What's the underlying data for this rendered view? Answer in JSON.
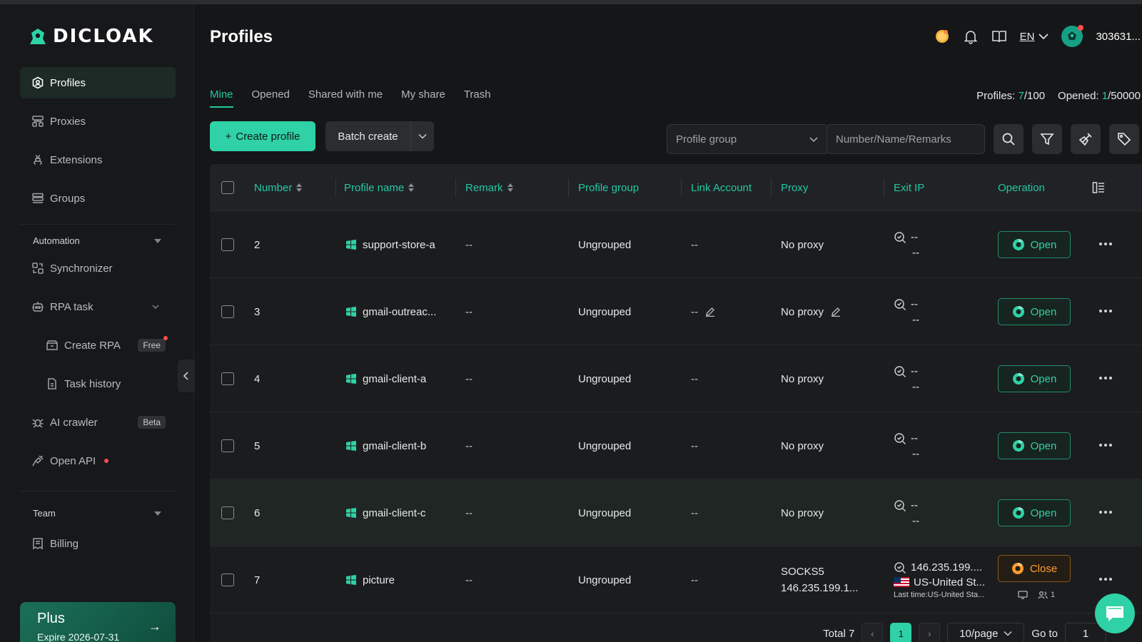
{
  "app": {
    "brand": "DICLOAK"
  },
  "sidebar": {
    "items": [
      {
        "label": "Profiles",
        "icon": "profiles-icon"
      },
      {
        "label": "Proxies",
        "icon": "proxies-icon"
      },
      {
        "label": "Extensions",
        "icon": "extensions-icon"
      },
      {
        "label": "Groups",
        "icon": "groups-icon"
      }
    ],
    "automation": {
      "label": "Automation",
      "synchronizer": "Synchronizer",
      "rpa_task": "RPA task",
      "create_rpa": "Create RPA",
      "create_rpa_badge": "Free",
      "task_history": "Task history",
      "ai_crawler": "AI crawler",
      "ai_crawler_badge": "Beta",
      "open_api": "Open API"
    },
    "team": {
      "label": "Team",
      "billing": "Billing"
    },
    "plan": {
      "name": "Plus",
      "expire": "Expire 2026-07-31"
    }
  },
  "header": {
    "title": "Profiles",
    "lang": "EN",
    "user_id": "303631..."
  },
  "tabs": [
    "Mine",
    "Opened",
    "Shared with me",
    "My share",
    "Trash"
  ],
  "counts": {
    "profiles_label": "Profiles:",
    "profiles_used": "7",
    "profiles_total": "/100",
    "opened_label": "Opened:",
    "opened_used": "1",
    "opened_total": "/50000"
  },
  "toolbar": {
    "create_label": "Create profile",
    "batch_label": "Batch create",
    "group_select": "Profile group",
    "search_placeholder": "Number/Name/Remarks"
  },
  "table": {
    "columns": {
      "number": "Number",
      "name": "Profile name",
      "remark": "Remark",
      "group": "Profile group",
      "link": "Link Account",
      "proxy": "Proxy",
      "exit_ip": "Exit IP",
      "operation": "Operation"
    },
    "rows": [
      {
        "number": "2",
        "name": "support-store-a",
        "remark": "--",
        "group": "Ungrouped",
        "link": "--",
        "proxy": "No proxy",
        "exit1": "--",
        "exit2": "--",
        "action": "Open"
      },
      {
        "number": "3",
        "name": "gmail-outreac...",
        "remark": "--",
        "group": "Ungrouped",
        "link": "--",
        "proxy": "No proxy",
        "exit1": "--",
        "exit2": "--",
        "action": "Open"
      },
      {
        "number": "4",
        "name": "gmail-client-a",
        "remark": "--",
        "group": "Ungrouped",
        "link": "--",
        "proxy": "No proxy",
        "exit1": "--",
        "exit2": "--",
        "action": "Open"
      },
      {
        "number": "5",
        "name": "gmail-client-b",
        "remark": "--",
        "group": "Ungrouped",
        "link": "--",
        "proxy": "No proxy",
        "exit1": "--",
        "exit2": "--",
        "action": "Open"
      },
      {
        "number": "6",
        "name": "gmail-client-c",
        "remark": "--",
        "group": "Ungrouped",
        "link": "--",
        "proxy": "No proxy",
        "exit1": "--",
        "exit2": "--",
        "action": "Open"
      },
      {
        "number": "7",
        "name": "picture",
        "remark": "--",
        "group": "Ungrouped",
        "link": "--",
        "proxy_type": "SOCKS5",
        "proxy_addr": "146.235.199.1...",
        "exit1": "146.235.199....",
        "exit2": "US-United St...",
        "exit_note": "Last time:US-United Sta...",
        "action": "Close",
        "user_count": "1"
      }
    ]
  },
  "pagination": {
    "total": "Total 7",
    "current": "1",
    "page_size": "10/page",
    "goto_label": "Go to",
    "goto_value": "1"
  },
  "colors": {
    "accent": "#2fd1a6",
    "close": "#ff9c2e",
    "bg": "#151617"
  }
}
